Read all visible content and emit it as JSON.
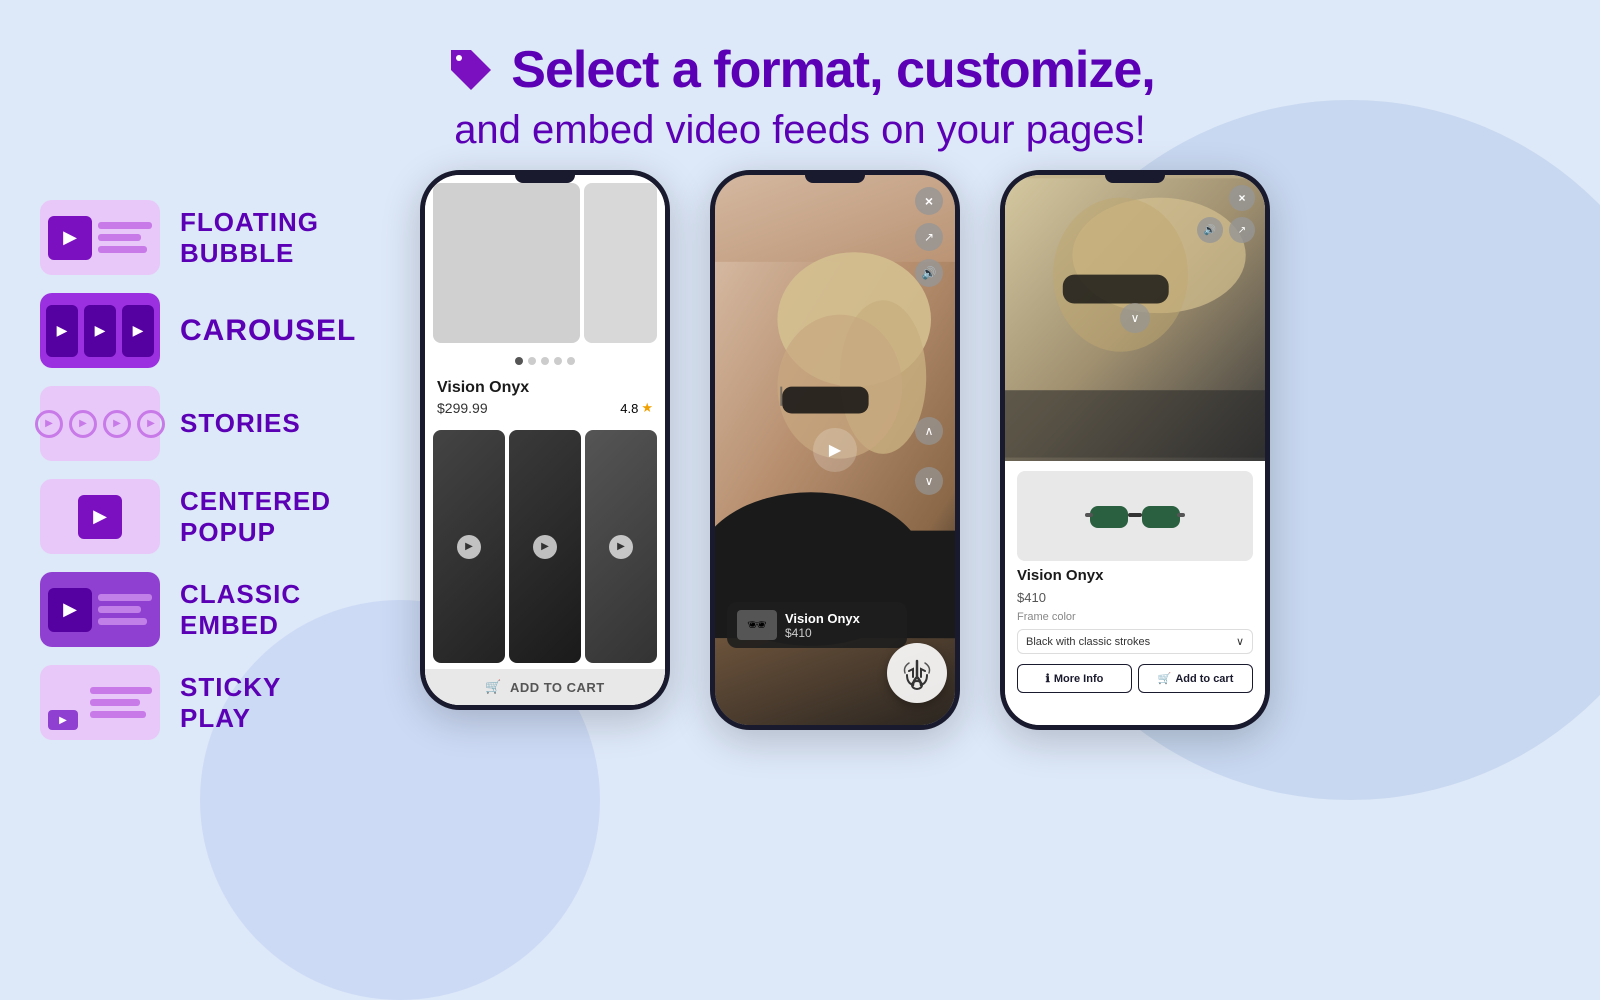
{
  "page": {
    "bg_color": "#dde8f8"
  },
  "header": {
    "title_line1": "Select a format, customize,",
    "title_line2": "and embed video feeds on your pages!",
    "tag_icon": "🏷"
  },
  "sidebar": {
    "items": [
      {
        "id": "floating-bubble",
        "label": "FLOATING BUBBLE",
        "active": false,
        "icon_type": "play_lines"
      },
      {
        "id": "carousel",
        "label": "CAROUSEL",
        "active": true,
        "icon_type": "carousel"
      },
      {
        "id": "stories",
        "label": "STORIES",
        "active": false,
        "icon_type": "circles"
      },
      {
        "id": "centered-popup",
        "label": "CENTERED POPUP",
        "active": false,
        "icon_type": "play_center"
      },
      {
        "id": "classic-embed",
        "label": "CLASSIC EMBED",
        "active": false,
        "icon_type": "play_lines"
      },
      {
        "id": "sticky-play",
        "label": "STICKY PLAY",
        "active": false,
        "icon_type": "play_dot"
      }
    ]
  },
  "phone1": {
    "product_name": "Vision Onyx",
    "product_price": "$299.99",
    "product_rating": "4.8",
    "add_to_cart": "ADD TO CART",
    "dots": [
      {
        "active": true
      },
      {
        "active": false
      },
      {
        "active": false
      },
      {
        "active": false
      },
      {
        "active": false
      }
    ]
  },
  "phone2": {
    "product_name": "Vision Onyx",
    "product_price": "$410",
    "close_btn": "×",
    "share_icon": "↗",
    "sound_icon": "🔊",
    "nav_up": "∧",
    "nav_down": "∨"
  },
  "phone3": {
    "product_name": "Vision Onyx",
    "product_price": "$410",
    "frame_color_label": "Frame color",
    "frame_color_value": "Black with classic strokes",
    "more_info_btn": "More Info",
    "add_to_cart_btn": "Add to cart",
    "close_btn": "×",
    "share_icon": "↗",
    "sound_icon": "🔊",
    "chevron": "∨"
  }
}
